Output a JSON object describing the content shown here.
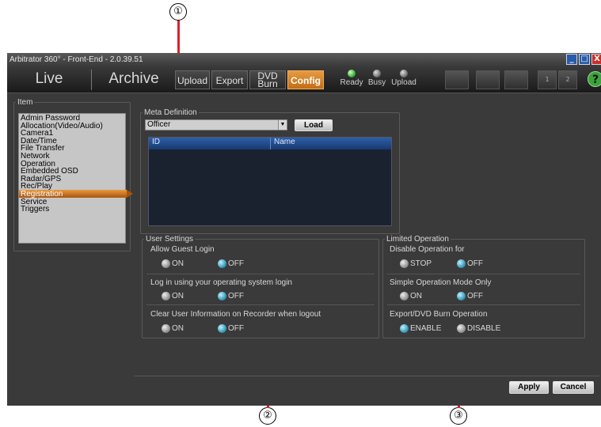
{
  "callouts": [
    "①",
    "②",
    "③"
  ],
  "window": {
    "title": "Arbitrator 360° - Front-End - 2.0.39.51",
    "controls": {
      "minimize": "_",
      "maximize": "□",
      "close": "X"
    }
  },
  "toolbar": {
    "live": "Live",
    "archive": "Archive",
    "upload": "Upload",
    "export": "Export",
    "dvd_burn_line1": "DVD",
    "dvd_burn_line2": "Burn",
    "config": "Config",
    "status": {
      "ready": "Ready",
      "busy": "Busy",
      "upload": "Upload"
    },
    "icon_pages": {
      "p1": "1",
      "p2": "2"
    },
    "help": "?"
  },
  "item_panel": {
    "legend": "Item",
    "items": [
      "Admin Password",
      "Allocation(Video/Audio)",
      "Camera1",
      "Date/Time",
      "File Transfer",
      "Network",
      "Operation",
      "Embedded OSD",
      "Radar/GPS",
      "Rec/Play",
      "Registration",
      "Service",
      "Triggers"
    ],
    "selected": "Registration"
  },
  "meta_definition": {
    "legend": "Meta Definition",
    "selected_value": "Officer",
    "load_button": "Load",
    "columns": [
      "ID",
      "Name"
    ]
  },
  "user_settings": {
    "legend": "User Settings",
    "allow_guest_login": {
      "label": "Allow Guest Login",
      "on": "ON",
      "off": "OFF",
      "selected": "OFF"
    },
    "os_login": {
      "label": "Log in using your operating system login",
      "on": "ON",
      "off": "OFF",
      "selected": "OFF"
    },
    "clear_user_info": {
      "label": "Clear User Information on Recorder when logout",
      "on": "ON",
      "off": "OFF",
      "selected": "OFF"
    }
  },
  "limited_operation": {
    "legend": "Limited Operation",
    "disable_operation": {
      "label": "Disable Operation for",
      "stop": "STOP",
      "off": "OFF",
      "selected": "OFF"
    },
    "simple_mode": {
      "label": "Simple Operation Mode Only",
      "on": "ON",
      "off": "OFF",
      "selected": "OFF"
    },
    "export_dvd": {
      "label": "Export/DVD Burn Operation",
      "enable": "ENABLE",
      "disable": "DISABLE",
      "selected": "ENABLE"
    }
  },
  "footer": {
    "apply": "Apply",
    "cancel": "Cancel"
  }
}
